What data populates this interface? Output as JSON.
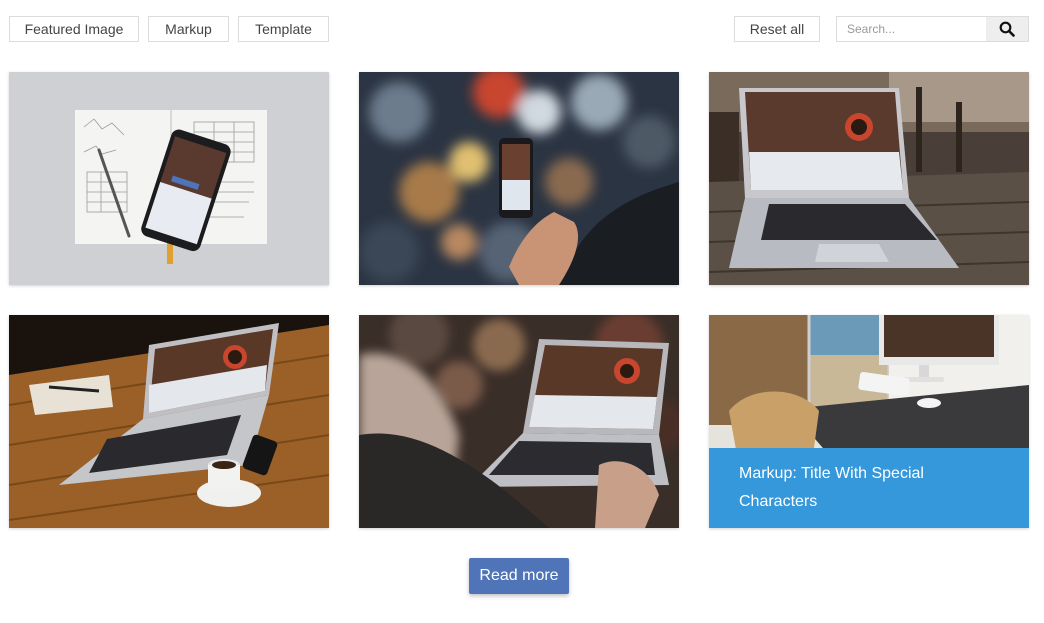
{
  "filters": {
    "featured_image": "Featured Image",
    "markup": "Markup",
    "template": "Template",
    "reset_all": "Reset all"
  },
  "search": {
    "placeholder": "Search...",
    "value": "",
    "icon": "search-icon"
  },
  "posts": [
    {
      "image": "phone-on-notebook-photo",
      "caption": ""
    },
    {
      "image": "hand-holding-phone-photo",
      "caption": ""
    },
    {
      "image": "laptop-on-outdoor-table-photo",
      "caption": ""
    },
    {
      "image": "laptop-on-wooden-desk-photo",
      "caption": ""
    },
    {
      "image": "person-using-laptop-photo",
      "caption": ""
    },
    {
      "image": "desktop-computer-office-photo",
      "caption": "Markup: Title With Special Characters"
    }
  ],
  "pagination": {
    "read_more": "Read more"
  },
  "colors": {
    "caption_bg": "#3498db",
    "button_bg": "#4f74b8"
  }
}
